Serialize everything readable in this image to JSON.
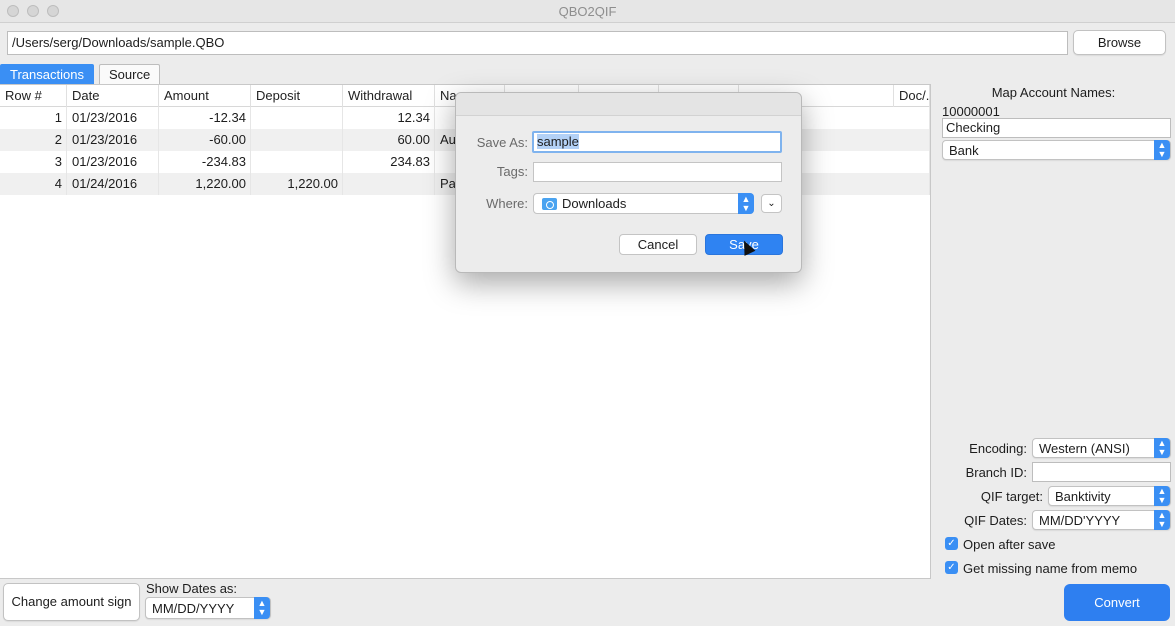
{
  "window": {
    "title": "QBO2QIF"
  },
  "path": {
    "value": "/Users/serg/Downloads/sample.QBO",
    "browse_label": "Browse"
  },
  "tabs": [
    {
      "label": "Transactions",
      "active": true
    },
    {
      "label": "Source",
      "active": false
    }
  ],
  "table": {
    "headers": [
      "Row #",
      "Date",
      "Amount",
      "Deposit",
      "Withdrawal",
      "Na",
      "",
      "",
      "",
      "",
      "Doc/."
    ],
    "rows": [
      {
        "row": "1",
        "date": "01/23/2016",
        "amount": "-12.34",
        "deposit": "",
        "withdrawal": "12.34",
        "name": ""
      },
      {
        "row": "2",
        "date": "01/23/2016",
        "amount": "-60.00",
        "deposit": "",
        "withdrawal": "60.00",
        "name": "Au"
      },
      {
        "row": "3",
        "date": "01/23/2016",
        "amount": "-234.83",
        "deposit": "",
        "withdrawal": "234.83",
        "name": ""
      },
      {
        "row": "4",
        "date": "01/24/2016",
        "amount": "1,220.00",
        "deposit": "1,220.00",
        "withdrawal": "",
        "name": "Pa"
      }
    ]
  },
  "map_panel": {
    "title": "Map Account Names:",
    "account_number": "10000001",
    "account_name": "Checking",
    "account_type": "Bank"
  },
  "settings": {
    "encoding_label": "Encoding:",
    "encoding_value": "Western (ANSI)",
    "branch_label": "Branch ID:",
    "branch_value": "",
    "qif_target_label": "QIF target:",
    "qif_target_value": "Banktivity",
    "qif_dates_label": "QIF Dates:",
    "qif_dates_value": "MM/DD'YYYY",
    "open_after_save": "Open after save",
    "missing_name": "Get missing name from memo"
  },
  "bottom": {
    "change_sign_label": "Change amount sign",
    "show_dates_label": "Show Dates as:",
    "show_dates_value": "MM/DD/YYYY",
    "convert_label": "Convert"
  },
  "dialog": {
    "save_as_label": "Save As:",
    "save_as_value": "sample",
    "tags_label": "Tags:",
    "where_label": "Where:",
    "where_value": "Downloads",
    "cancel_label": "Cancel",
    "save_label": "Save"
  },
  "colors": {
    "accent": "#3a8ff4",
    "convert": "#2e7ff0"
  }
}
